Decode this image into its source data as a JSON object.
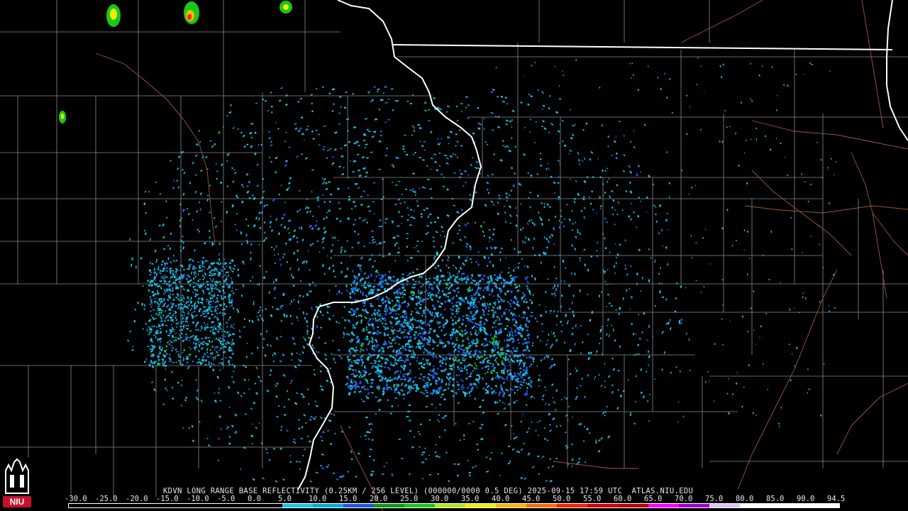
{
  "product": {
    "caption": "KDVN LONG RANGE BASE REFLECTIVITY (0.25KM / 256 LEVEL) (000000/0000 0.5 DEG) 2025-09-15 17:59 UTC  ATLAS.NIU.EDU"
  },
  "scale": {
    "labels": [
      "-30.0",
      "-25.0",
      "-20.0",
      "-15.0",
      "-10.0",
      "-5.0",
      "0.0",
      "5.0",
      "10.0",
      "15.0",
      "20.0",
      "25.0",
      "30.0",
      "35.0",
      "40.0",
      "45.0",
      "50.0",
      "55.0",
      "60.0",
      "65.0",
      "70.0",
      "75.0",
      "80.0",
      "85.0",
      "90.0",
      "94.5"
    ],
    "colors": [
      "#000000",
      "#000000",
      "#000000",
      "#000000",
      "#000000",
      "#000000",
      "#000000",
      "#16c8e6",
      "#0aa8d8",
      "#1e58e0",
      "#0c9a18",
      "#18c81e",
      "#b2e61e",
      "#f0f000",
      "#ffb400",
      "#ff6a00",
      "#ff2000",
      "#d00000",
      "#b40000",
      "#ff00ff",
      "#a000d0",
      "#e0c0ff",
      "#ffffff",
      "#ffffff",
      "#ffffff"
    ]
  },
  "logo": {
    "text": "NIU",
    "accent_color": "#c8102e"
  },
  "map_colors": {
    "background": "#000000",
    "county_lines": "#8a8a8a",
    "state_lines": "#ffffff",
    "roads": "#9a5a3a"
  }
}
